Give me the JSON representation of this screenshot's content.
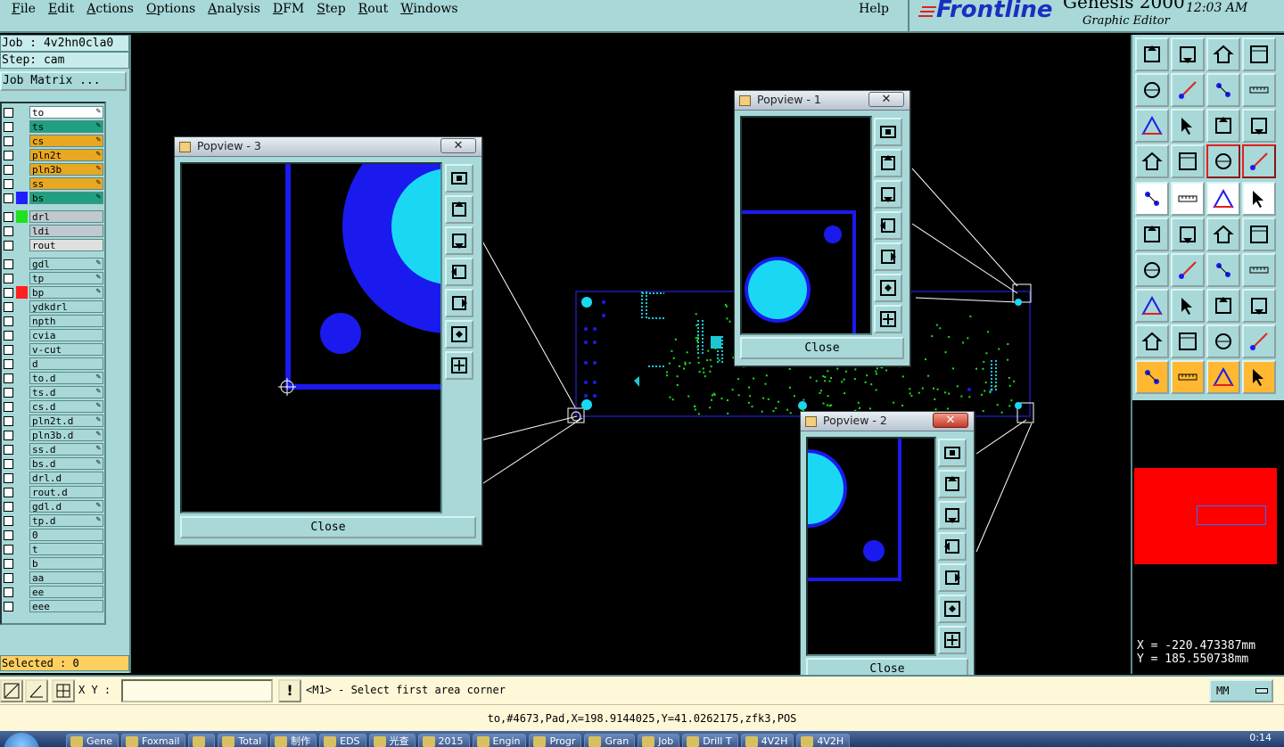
{
  "menu": {
    "items": [
      "File",
      "Edit",
      "Actions",
      "Options",
      "Analysis",
      "DFM",
      "Step",
      "Rout",
      "Windows"
    ],
    "help": "Help"
  },
  "brand": {
    "logo": "Frontline",
    "product": "Genesis 2000",
    "subtitle": "Graphic Editor",
    "clock": "12:03 AM"
  },
  "job": {
    "job_line": "Job : 4v2hn0cla0",
    "step_line": "Step: cam",
    "matrix_button": "Job Matrix ..."
  },
  "layers": {
    "group1": [
      {
        "name": "to",
        "color": "#ffffff",
        "swatch": "",
        "editable": true
      },
      {
        "name": "ts",
        "color": "#20a080",
        "swatch": "",
        "editable": true
      },
      {
        "name": "cs",
        "color": "#e8a820",
        "swatch": "",
        "editable": true
      },
      {
        "name": "pln2t",
        "color": "#e8a820",
        "swatch": "",
        "editable": true
      },
      {
        "name": "pln3b",
        "color": "#e8a820",
        "swatch": "",
        "editable": true
      },
      {
        "name": "ss",
        "color": "#e8a820",
        "swatch": "",
        "editable": true
      },
      {
        "name": "bs",
        "color": "#20a080",
        "swatch": "#2020ff",
        "editable": true
      }
    ],
    "group2": [
      {
        "name": "drl",
        "color": "#c0c8d0",
        "swatch": "#20e020",
        "editable": false
      },
      {
        "name": "ldi",
        "color": "#c0c8d0",
        "swatch": "",
        "editable": false
      },
      {
        "name": "rout",
        "color": "#e0e0e0",
        "swatch": "",
        "editable": false
      }
    ],
    "group3": [
      {
        "name": "gdl",
        "color": "#a8d8d8",
        "swatch": "",
        "editable": true
      },
      {
        "name": "tp",
        "color": "#a8d8d8",
        "swatch": "",
        "editable": true
      },
      {
        "name": "bp",
        "color": "#a8d8d8",
        "swatch": "#ff2020",
        "editable": true
      },
      {
        "name": "ydkdrl",
        "color": "#a8d8d8",
        "swatch": "",
        "editable": false
      },
      {
        "name": "npth",
        "color": "#a8d8d8",
        "swatch": "",
        "editable": false
      },
      {
        "name": "cvia",
        "color": "#a8d8d8",
        "swatch": "",
        "editable": false
      },
      {
        "name": "v-cut",
        "color": "#a8d8d8",
        "swatch": "",
        "editable": false
      },
      {
        "name": "d",
        "color": "#a8d8d8",
        "swatch": "",
        "editable": false
      },
      {
        "name": "to.d",
        "color": "#a8d8d8",
        "swatch": "",
        "editable": true
      },
      {
        "name": "ts.d",
        "color": "#a8d8d8",
        "swatch": "",
        "editable": true
      },
      {
        "name": "cs.d",
        "color": "#a8d8d8",
        "swatch": "",
        "editable": true
      },
      {
        "name": "pln2t.d",
        "color": "#a8d8d8",
        "swatch": "",
        "editable": true
      },
      {
        "name": "pln3b.d",
        "color": "#a8d8d8",
        "swatch": "",
        "editable": true
      },
      {
        "name": "ss.d",
        "color": "#a8d8d8",
        "swatch": "",
        "editable": true
      },
      {
        "name": "bs.d",
        "color": "#a8d8d8",
        "swatch": "",
        "editable": true
      },
      {
        "name": "drl.d",
        "color": "#a8d8d8",
        "swatch": "",
        "editable": false
      },
      {
        "name": "rout.d",
        "color": "#a8d8d8",
        "swatch": "",
        "editable": false
      },
      {
        "name": "gdl.d",
        "color": "#a8d8d8",
        "swatch": "",
        "editable": true
      },
      {
        "name": "tp.d",
        "color": "#a8d8d8",
        "swatch": "",
        "editable": true
      },
      {
        "name": "0",
        "color": "#a8d8d8",
        "swatch": "",
        "editable": false
      },
      {
        "name": "t",
        "color": "#a8d8d8",
        "swatch": "",
        "editable": false
      },
      {
        "name": "b",
        "color": "#a8d8d8",
        "swatch": "",
        "editable": false
      },
      {
        "name": "aa",
        "color": "#a8d8d8",
        "swatch": "",
        "editable": false
      },
      {
        "name": "ee",
        "color": "#a8d8d8",
        "swatch": "",
        "editable": false
      },
      {
        "name": "eee",
        "color": "#a8d8d8",
        "swatch": "",
        "editable": false
      }
    ]
  },
  "selected": "Selected : 0",
  "popviews": {
    "p1": {
      "title": "Popview - 1",
      "close": "Close"
    },
    "p2": {
      "title": "Popview - 2",
      "close": "Close"
    },
    "p3": {
      "title": "Popview - 3",
      "close": "Close"
    }
  },
  "coords": {
    "x": "X = -220.473387mm",
    "y": "Y = 185.550738mm"
  },
  "cmd": {
    "xy_label": "X Y :",
    "xy_value": "",
    "excl": "!",
    "prompt": "<M1> - Select first area corner",
    "units": "MM"
  },
  "status": "to,#4673,Pad,X=198.9144025,Y=41.0262175,zfk3,POS",
  "taskbar": {
    "tasks": [
      "Gene",
      "Foxmail",
      "",
      "Total",
      "制作",
      "EDS",
      "光查",
      "2015",
      "Engin",
      "Progr",
      "Gran",
      "Job",
      "Drill T",
      "4V2H",
      "4V2H"
    ],
    "time": "0:14"
  },
  "colors": {
    "panel": "#a8d8d8",
    "selected_bg": "#ffd060",
    "pad_blue": "#1a1aee",
    "pad_cyan": "#1ad8f4",
    "drill_green": "#20e020"
  },
  "right_tools": [
    "move-up-icon",
    "move-down-icon",
    "home-icon",
    "window-icon",
    "move-left-icon",
    "move-right-icon",
    "zoom-fit-icon",
    "wave-icon",
    "fit-screen-icon",
    "pan-icon",
    "ratio-icon",
    "help-icon",
    "tools-icon",
    "grid-icon",
    "snap-red-icon",
    "snap-red2-icon",
    "pad-select-icon",
    "line-select-icon",
    "measure-icon",
    "pad-dark-icon",
    "net-icon",
    "cross-icon",
    "arrow-pad-icon",
    "arrow-pad2-icon",
    "line-red-icon",
    "line-blue-icon",
    "rotate-icon",
    "split-icon",
    "pad-red-icon",
    "line-h-icon",
    "dim-icon",
    "blob-icon",
    "triangle-icon",
    "triangle2-icon",
    "arch-icon",
    "arch2-icon",
    "pointer-icon",
    "pointer-box-icon",
    "pointer-box2-icon",
    "route-icon"
  ]
}
